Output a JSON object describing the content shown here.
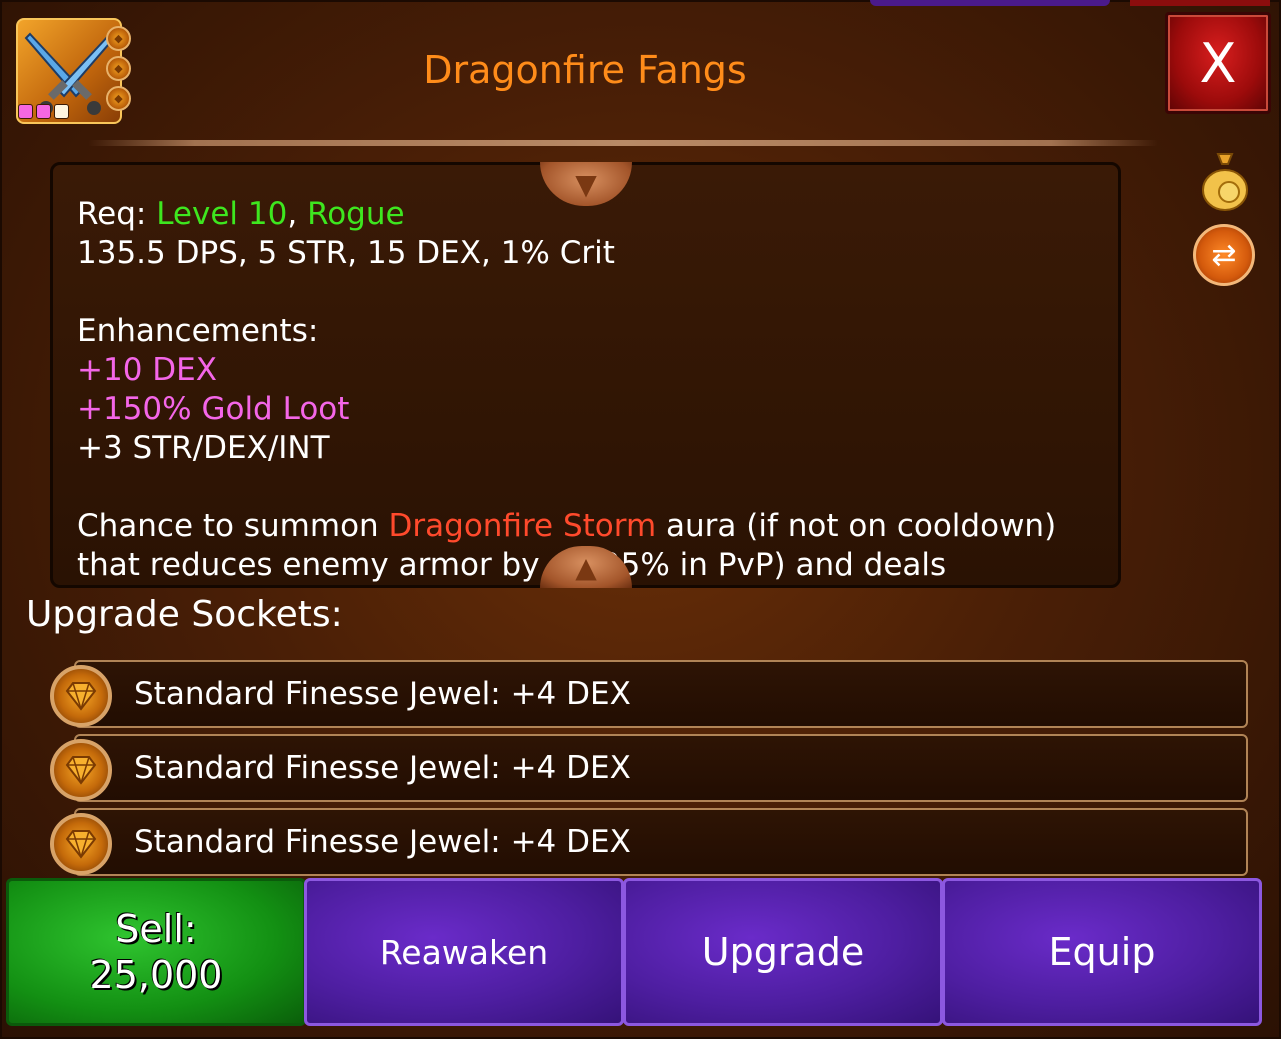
{
  "item": {
    "title": "Dragonfire Fangs",
    "rarity_pips": [
      "#f567e0",
      "#f567e0",
      "#fff6e0"
    ],
    "icon_name": "crossed-daggers-icon"
  },
  "close_label": "X",
  "description": {
    "req_prefix": "Req: ",
    "req_level": "Level 10",
    "req_sep": ", ",
    "req_class": "Rogue",
    "stats": "135.5 DPS, 5 STR, 15 DEX, 1% Crit",
    "enhancements_header": "Enhancements:",
    "enh_1": "+10 DEX",
    "enh_2": "+150% Gold Loot",
    "enh_3": "+3 STR/DEX/INT",
    "chance_prefix": "Chance to summon ",
    "chance_aura": "Dragonfire Storm",
    "chance_suffix": " aura (if not on cooldown)",
    "cut_line": "that reduces enemy armor by ... (25% in PvP) and deals"
  },
  "sockets": {
    "title": "Upgrade Sockets:",
    "items": [
      {
        "label": "Standard Finesse Jewel: +4 DEX"
      },
      {
        "label": "Standard Finesse Jewel: +4 DEX"
      },
      {
        "label": "Standard Finesse Jewel: +4 DEX"
      }
    ]
  },
  "buttons": {
    "sell_label": "Sell:",
    "sell_price": "25,000",
    "reawaken": "Reawaken",
    "upgrade": "Upgrade",
    "equip": "Equip"
  },
  "colors": {
    "title": "#ff8c1a",
    "requirement": "#3ee61f",
    "enhancement": "#f466e8",
    "aura": "#ff4a2c",
    "sell_button": "#139013",
    "action_button": "#4e1ea1"
  }
}
